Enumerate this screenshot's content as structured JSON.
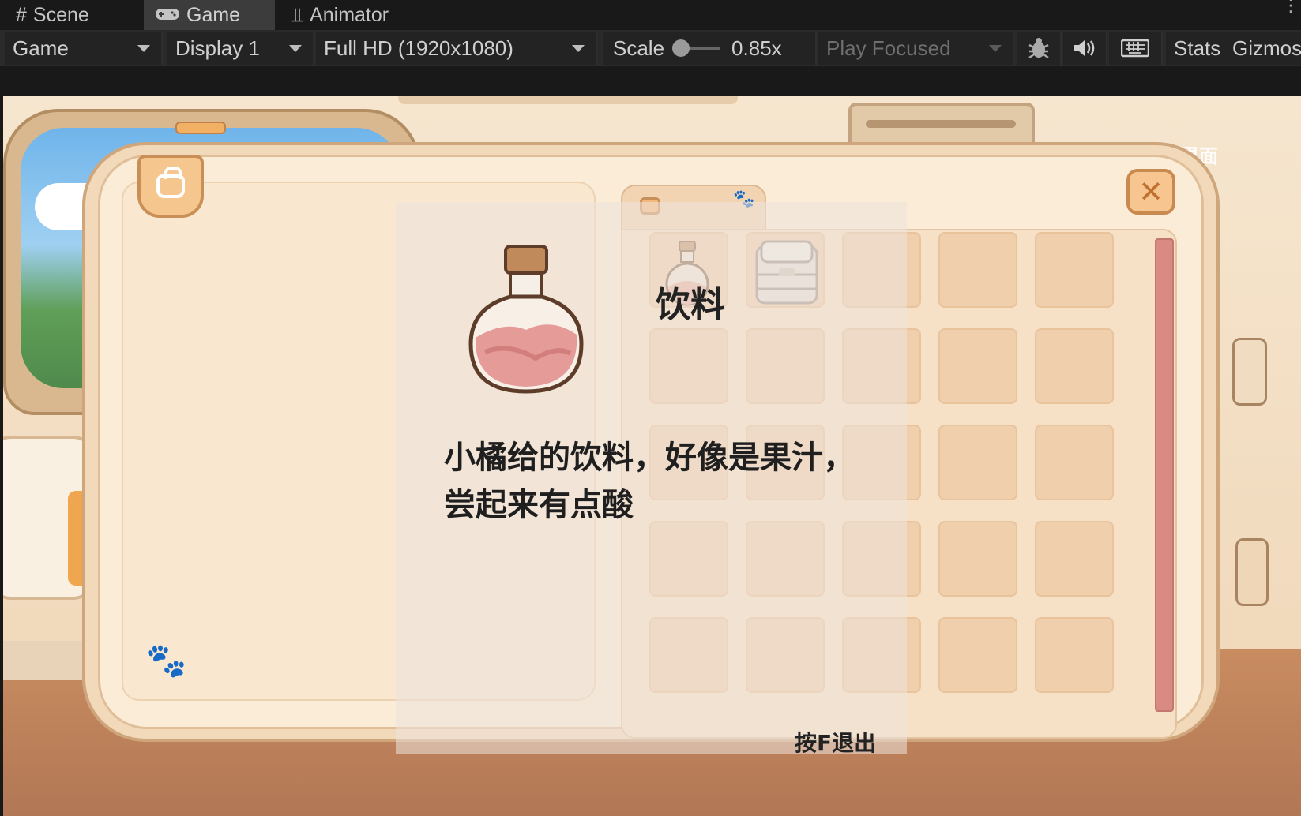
{
  "editor": {
    "tabs": [
      {
        "label": "Scene",
        "icon": "grid-icon"
      },
      {
        "label": "Game",
        "icon": "gamepad-icon",
        "active": true
      },
      {
        "label": "Animator",
        "icon": "animator-icon"
      }
    ],
    "toolbar": {
      "view_select": "Game",
      "display_select": "Display 1",
      "resolution_select": "Full HD (1920x1080)",
      "scale_label": "Scale",
      "scale_value": "0.85x",
      "play_focus_select": "Play Focused",
      "stats_label": "Stats",
      "gizmos_label": "Gizmos"
    }
  },
  "game": {
    "background_label": "界面",
    "inventory": {
      "selected_item_name": "饮料",
      "selected_item_description": "小橘给的饮料，好像是果汁，尝起来有点酸",
      "exit_hint": "按F退出",
      "close_symbol": "✕",
      "grid": {
        "rows": 5,
        "cols": 5,
        "items": [
          "potion-icon",
          "storage-crate-icon"
        ]
      },
      "colors": {
        "panel": "#f2d9b9",
        "slot": "#f0cfad",
        "scrollbar": "#d98b83",
        "close_button": "#f7c690"
      }
    }
  }
}
